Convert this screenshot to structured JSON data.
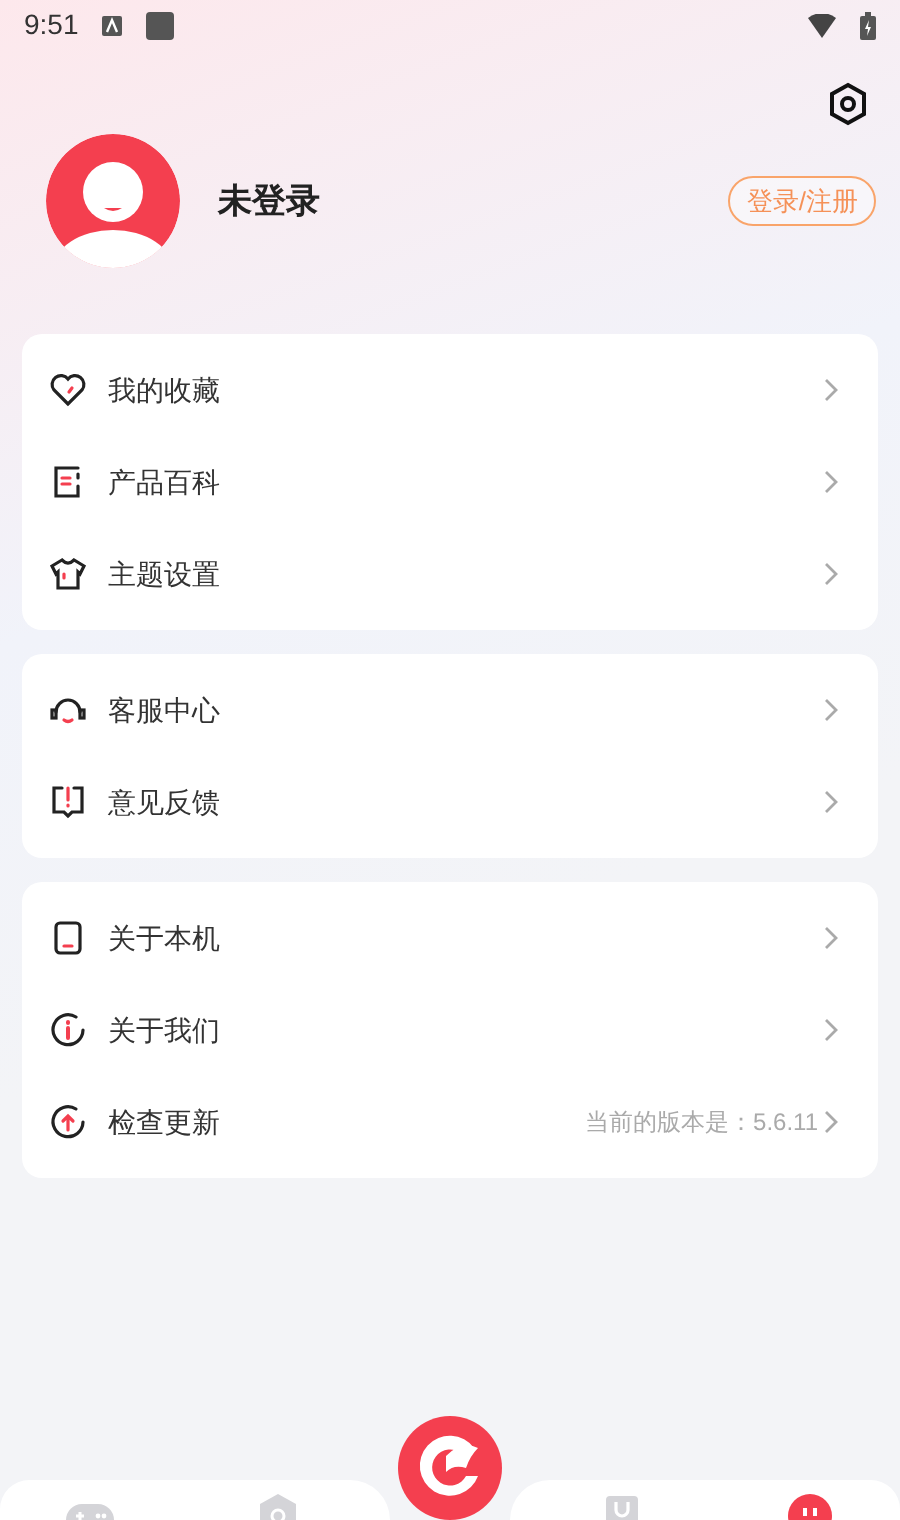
{
  "status_bar": {
    "time": "9:51"
  },
  "profile": {
    "name": "未登录",
    "login_button": "登录/注册"
  },
  "menu_groups": [
    {
      "items": [
        {
          "kind": "favorite",
          "label": "我的收藏"
        },
        {
          "kind": "wiki",
          "label": "产品百科"
        },
        {
          "kind": "theme",
          "label": "主题设置"
        }
      ]
    },
    {
      "items": [
        {
          "kind": "service",
          "label": "客服中心"
        },
        {
          "kind": "feedback",
          "label": "意见反馈"
        }
      ]
    },
    {
      "items": [
        {
          "kind": "device",
          "label": "关于本机"
        },
        {
          "kind": "about",
          "label": "关于我们"
        },
        {
          "kind": "update",
          "label": "检查更新",
          "value": "当前的版本是：5.6.11"
        }
      ]
    }
  ],
  "bottom_nav": [
    {
      "kind": "game",
      "selected": false
    },
    {
      "kind": "search",
      "selected": false
    },
    {
      "kind": "bag",
      "selected": false
    },
    {
      "kind": "mine",
      "selected": true
    }
  ]
}
